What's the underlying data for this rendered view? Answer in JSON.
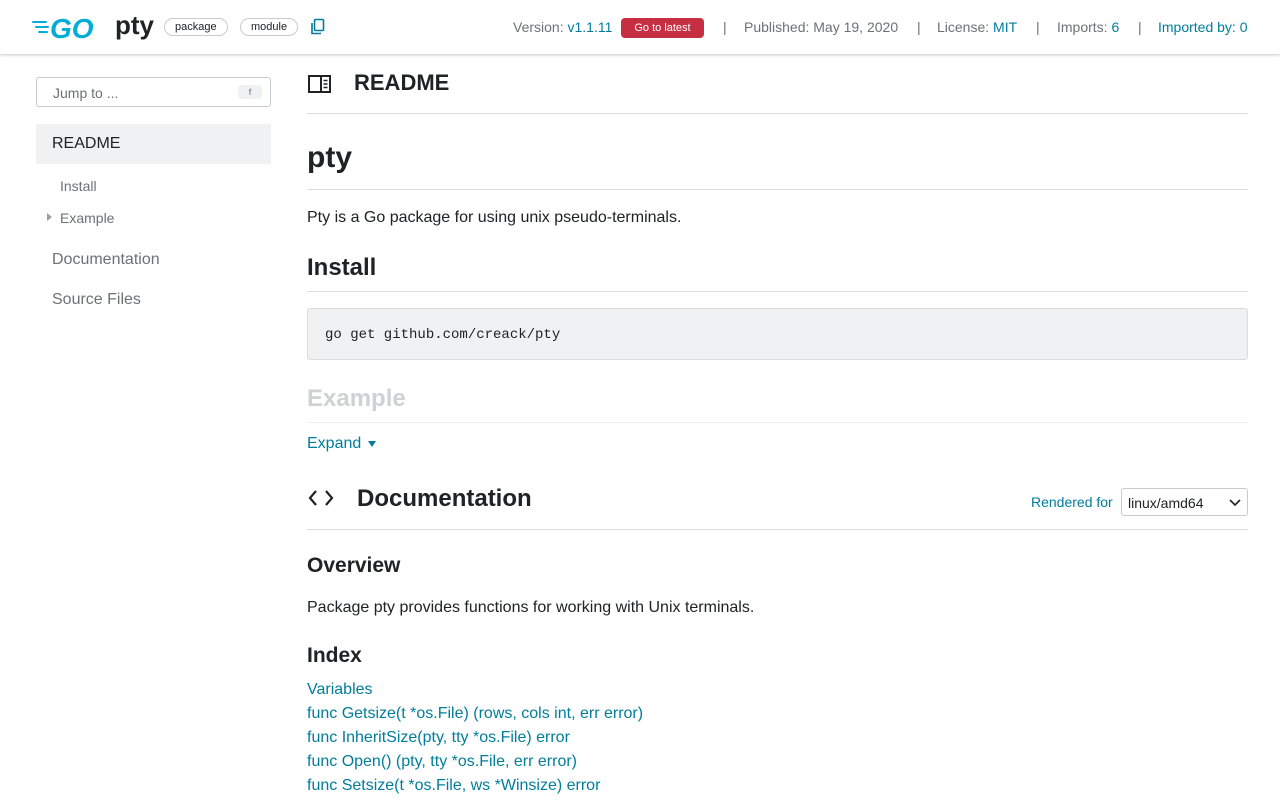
{
  "header": {
    "package_name": "pty",
    "badges": [
      "package",
      "module"
    ],
    "version_label": "Version:",
    "version_value": "v1.1.11",
    "latest_button": "Go to latest",
    "separator": "|",
    "published": "Published: May 19, 2020",
    "license_label": "License:",
    "license_value": "MIT",
    "imports_label": "Imports:",
    "imports_value": "6",
    "imported_by": "Imported by: 0",
    "icons": [
      "go-logo",
      "copy-icon"
    ],
    "colors": {
      "link": "#007d9c",
      "go_blue": "#00add8",
      "latest_red": "#c62e42"
    }
  },
  "sidebar": {
    "jump_placeholder": "Jump to ...",
    "jump_shortcut": "f",
    "readme": "README",
    "sub_items": [
      "Install",
      "Example"
    ],
    "items": [
      "Documentation",
      "Source Files"
    ]
  },
  "main": {
    "readme_heading": "README",
    "title": "pty",
    "description": "Pty is a Go package for using unix pseudo-terminals.",
    "install_heading": "Install",
    "install_code": "go get github.com/creack/pty",
    "example_heading": "Example",
    "expand_label": "Expand",
    "doc_heading": "Documentation",
    "rendered_for_label": "Rendered for",
    "platform": "linux/amd64",
    "overview_heading": "Overview",
    "overview_text": "Package pty provides functions for working with Unix terminals.",
    "index_heading": "Index",
    "index_items": [
      "Variables",
      "func Getsize(t *os.File) (rows, cols int, err error)",
      "func InheritSize(pty, tty *os.File) error",
      "func Open() (pty, tty *os.File, err error)",
      "func Setsize(t *os.File, ws *Winsize) error"
    ]
  }
}
